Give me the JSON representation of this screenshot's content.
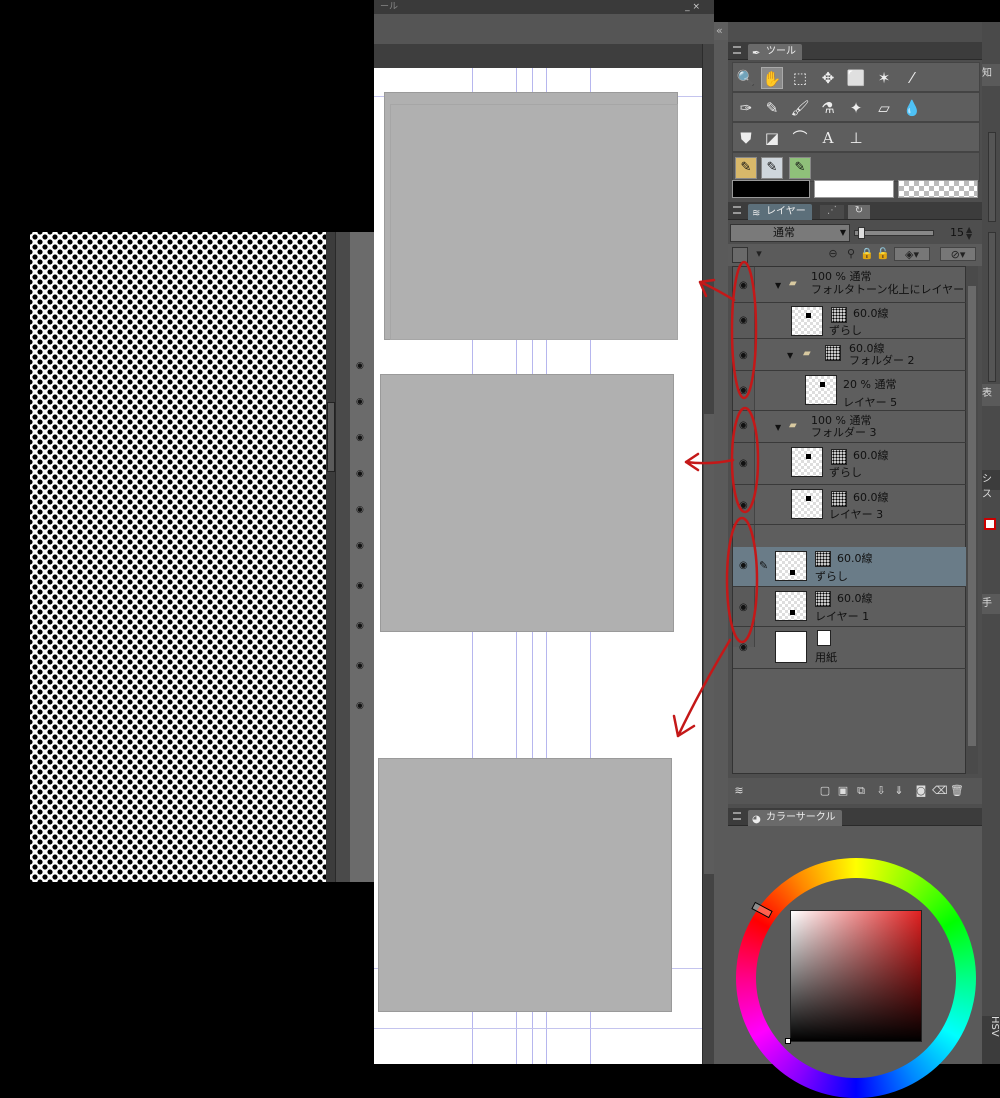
{
  "titlebar": {
    "fragment": "ール",
    "buttons": "_ ×"
  },
  "collapse_left": "«",
  "collapse_right": "»",
  "tool_panel": {
    "tab_label": "ツール"
  },
  "layer_panel": {
    "tab_label": "レイヤー",
    "blend_mode": "通常",
    "opacity_value": "15",
    "layers": [
      {
        "name": "フォルタトーン化上にレイヤー",
        "info": "100 %  通常",
        "type": "folder"
      },
      {
        "name": "ずらし",
        "info": "60.0線",
        "type": "layer"
      },
      {
        "name": "フォルダー 2",
        "info": "60.0線",
        "type": "folder"
      },
      {
        "name": "レイヤー 5",
        "info": "20 %  通常",
        "type": "layer"
      },
      {
        "name": "フォルダー 3",
        "info": "100 %  通常",
        "type": "folder"
      },
      {
        "name": "ずらし",
        "info": "60.0線",
        "type": "layer"
      },
      {
        "name": "レイヤー 3",
        "info": "60.0線",
        "type": "layer"
      },
      {
        "name": "ずらし",
        "info": "60.0線",
        "type": "layer",
        "selected": true
      },
      {
        "name": "レイヤー 1",
        "info": "60.0線",
        "type": "layer"
      },
      {
        "name": "用紙",
        "info": "",
        "type": "paper"
      }
    ]
  },
  "color_panel": {
    "tab_label": "カラーサークル",
    "side_tab": "HSV"
  },
  "right_edge": {
    "label_1": "知",
    "label_2": "表",
    "label_3": "シス",
    "label_4": "手"
  },
  "colors": {
    "annotation": "#c41818",
    "selected_layer": "#6a7c88",
    "panel_bg": "#4e4e4e"
  }
}
